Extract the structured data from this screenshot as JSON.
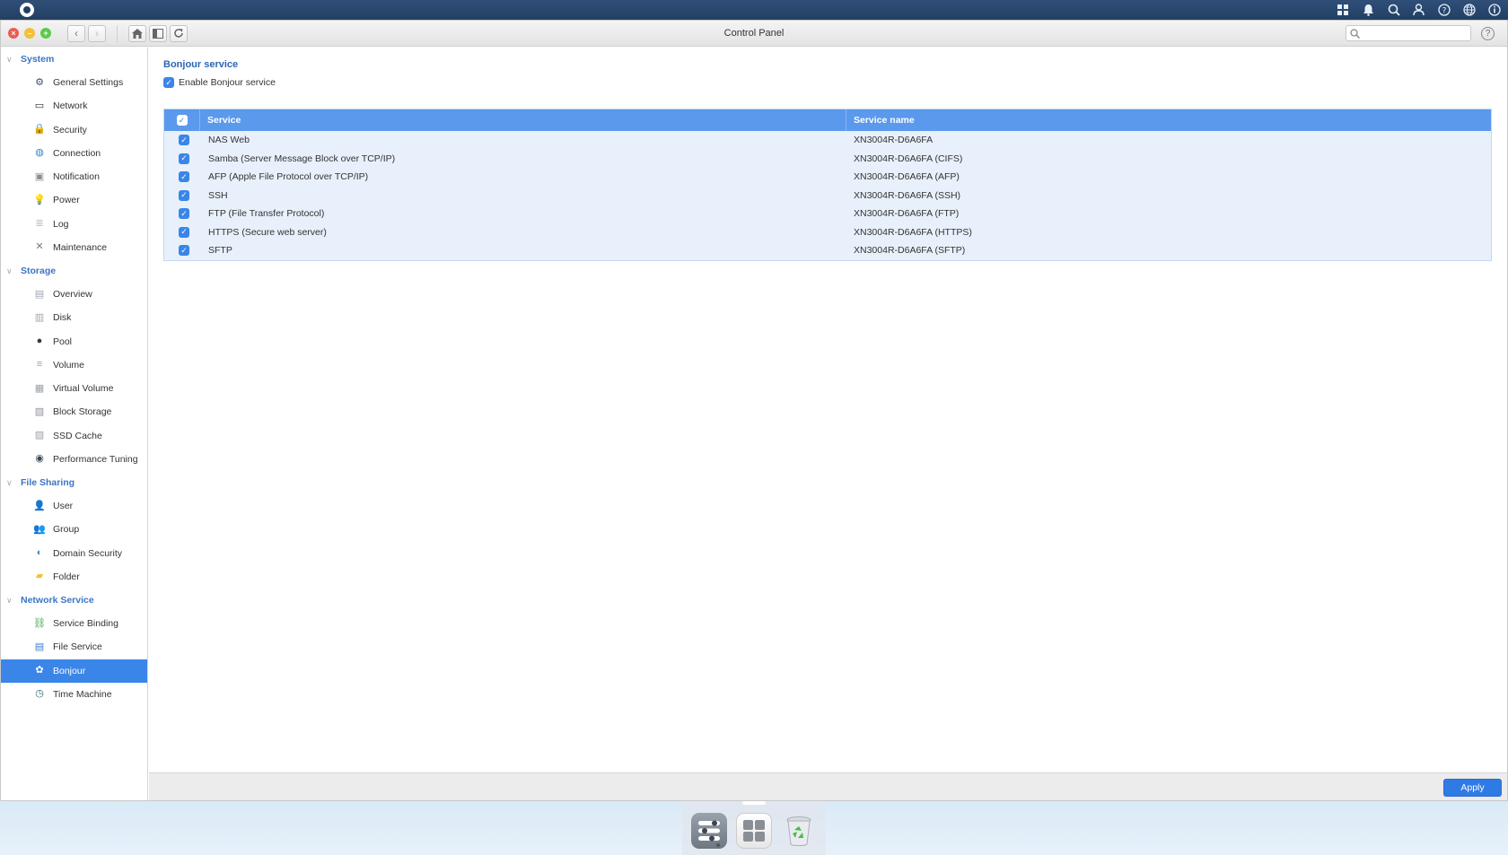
{
  "window": {
    "title": "Control Panel"
  },
  "search": {
    "placeholder": ""
  },
  "sidebar": {
    "sections": [
      {
        "label": "System",
        "items": [
          {
            "label": "General Settings",
            "icon": "gear-icon"
          },
          {
            "label": "Network",
            "icon": "network-icon"
          },
          {
            "label": "Security",
            "icon": "lock-icon"
          },
          {
            "label": "Connection",
            "icon": "globe-icon"
          },
          {
            "label": "Notification",
            "icon": "notification-icon"
          },
          {
            "label": "Power",
            "icon": "lightbulb-icon"
          },
          {
            "label": "Log",
            "icon": "log-icon"
          },
          {
            "label": "Maintenance",
            "icon": "tools-icon"
          }
        ]
      },
      {
        "label": "Storage",
        "items": [
          {
            "label": "Overview",
            "icon": "overview-icon"
          },
          {
            "label": "Disk",
            "icon": "disk-icon"
          },
          {
            "label": "Pool",
            "icon": "pool-icon"
          },
          {
            "label": "Volume",
            "icon": "volume-icon"
          },
          {
            "label": "Virtual Volume",
            "icon": "virtual-volume-icon"
          },
          {
            "label": "Block Storage",
            "icon": "block-storage-icon"
          },
          {
            "label": "SSD Cache",
            "icon": "ssd-cache-icon"
          },
          {
            "label": "Performance Tuning",
            "icon": "performance-icon"
          }
        ]
      },
      {
        "label": "File Sharing",
        "items": [
          {
            "label": "User",
            "icon": "user-icon"
          },
          {
            "label": "Group",
            "icon": "group-icon"
          },
          {
            "label": "Domain Security",
            "icon": "domain-security-icon"
          },
          {
            "label": "Folder",
            "icon": "folder-icon"
          }
        ]
      },
      {
        "label": "Network Service",
        "items": [
          {
            "label": "Service Binding",
            "icon": "service-binding-icon"
          },
          {
            "label": "File Service",
            "icon": "file-service-icon"
          },
          {
            "label": "Bonjour",
            "icon": "bonjour-icon",
            "active": true
          },
          {
            "label": "Time Machine",
            "icon": "time-machine-icon"
          }
        ]
      }
    ]
  },
  "main": {
    "title": "Bonjour service",
    "enable_label": "Enable Bonjour service",
    "enable_checked": true,
    "table": {
      "headers": [
        "Service",
        "Service name"
      ],
      "rows": [
        {
          "service": "NAS Web",
          "name": "XN3004R-D6A6FA",
          "checked": true
        },
        {
          "service": "Samba (Server Message Block over TCP/IP)",
          "name": "XN3004R-D6A6FA (CIFS)",
          "checked": true
        },
        {
          "service": "AFP (Apple File Protocol over TCP/IP)",
          "name": "XN3004R-D6A6FA (AFP)",
          "checked": true
        },
        {
          "service": "SSH",
          "name": "XN3004R-D6A6FA (SSH)",
          "checked": true
        },
        {
          "service": "FTP (File Transfer Protocol)",
          "name": "XN3004R-D6A6FA (FTP)",
          "checked": true
        },
        {
          "service": "HTTPS (Secure web server)",
          "name": "XN3004R-D6A6FA (HTTPS)",
          "checked": true
        },
        {
          "service": "SFTP",
          "name": "XN3004R-D6A6FA (SFTP)",
          "checked": true
        }
      ]
    },
    "apply_label": "Apply"
  },
  "colors": {
    "accent": "#3a86e8",
    "header": "#5a99ec",
    "section": "#3a75c4"
  }
}
